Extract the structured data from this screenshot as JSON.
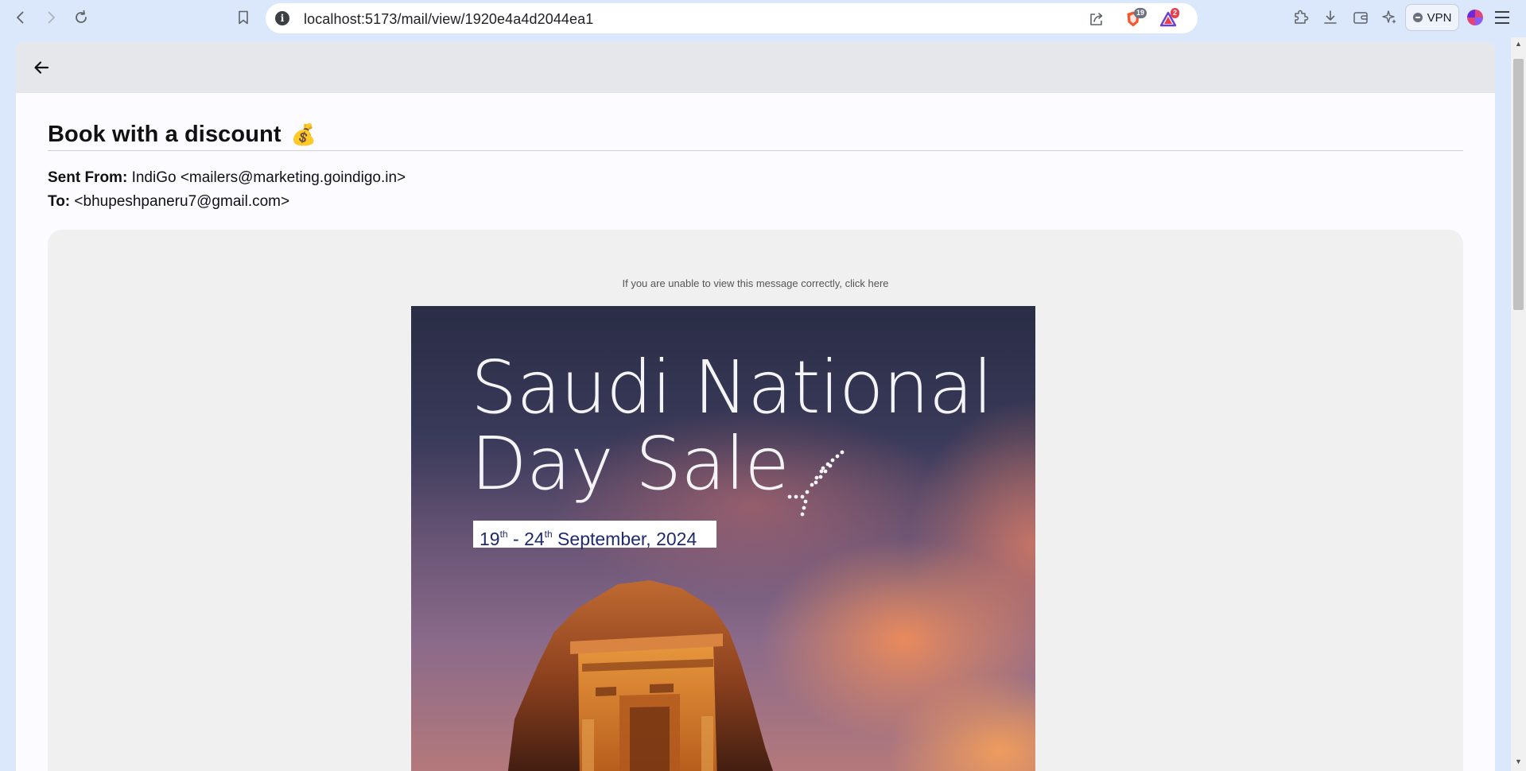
{
  "browser": {
    "url": "localhost:5173/mail/view/1920e4a4d2044ea1",
    "shields_count": "19",
    "rewards_count": "2",
    "vpn_label": "VPN"
  },
  "email": {
    "subject": "Book with a discount",
    "subject_emoji": "💰",
    "from_label": "Sent From:",
    "from_value": "IndiGo <mailers@marketing.goindigo.in>",
    "to_label": "To:",
    "to_value": "<bhupeshpaneru7@gmail.com>",
    "view_note": "If you are unable to view this message correctly, click here"
  },
  "banner": {
    "title_line1": "Saudi National",
    "title_line2": "Day Sale",
    "date_start_day": "19",
    "date_start_sup": "th",
    "date_sep": " - ",
    "date_end_day": "24",
    "date_end_sup": "th",
    "date_rest": " September, 2024"
  },
  "colors": {
    "header_bg": "#e5e7eb",
    "page_bg": "#fcfbff",
    "mail_bg": "#f0f0f0",
    "date_text": "#1f2a6b",
    "browser_bg": "#dbe7fb"
  }
}
